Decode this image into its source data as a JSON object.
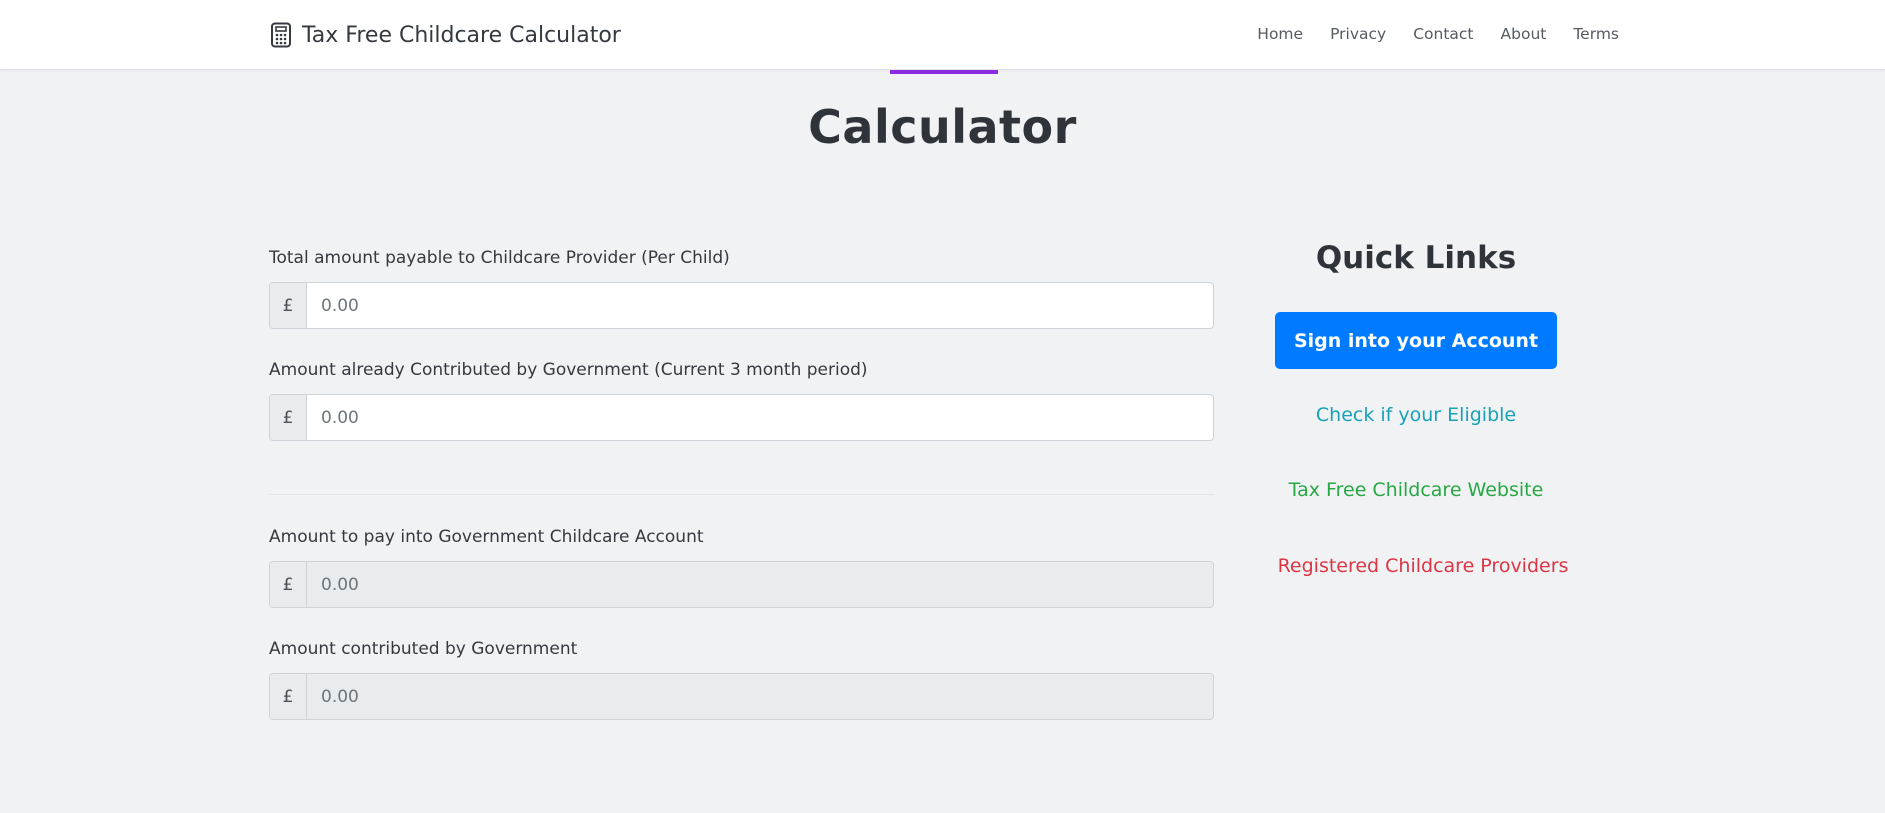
{
  "navbar": {
    "brand_icon": "calculator-icon",
    "brand": "Tax Free Childcare Calculator",
    "links": [
      "Home",
      "Privacy",
      "Contact",
      "About",
      "Terms"
    ]
  },
  "page": {
    "title": "Calculator",
    "accent_color": "#8a2be2"
  },
  "form": {
    "fields": [
      {
        "label": "Total amount payable to Childcare Provider (Per Child)",
        "prefix": "£",
        "placeholder": "0.00",
        "value": "",
        "readonly": false
      },
      {
        "label": "Amount already Contributed by Government (Current 3 month period)",
        "prefix": "£",
        "placeholder": "0.00",
        "value": "",
        "readonly": false
      }
    ],
    "results": [
      {
        "label": "Amount to pay into Government Childcare Account",
        "prefix": "£",
        "placeholder": "0.00",
        "value": "",
        "readonly": true
      },
      {
        "label": "Amount contributed by Government",
        "prefix": "£",
        "placeholder": "0.00",
        "value": "",
        "readonly": true
      }
    ]
  },
  "quick_links": {
    "title": "Quick Links",
    "sign_in_button": "Sign into your Account",
    "check_eligible": "Check if your Eligible",
    "tfc_website": "Tax Free Childcare Website",
    "registered_providers": "Registered Childcare Providers",
    "colors": {
      "primary": "#007bff",
      "info": "#17a2b8",
      "success": "#28a745",
      "danger": "#dc3545"
    }
  }
}
